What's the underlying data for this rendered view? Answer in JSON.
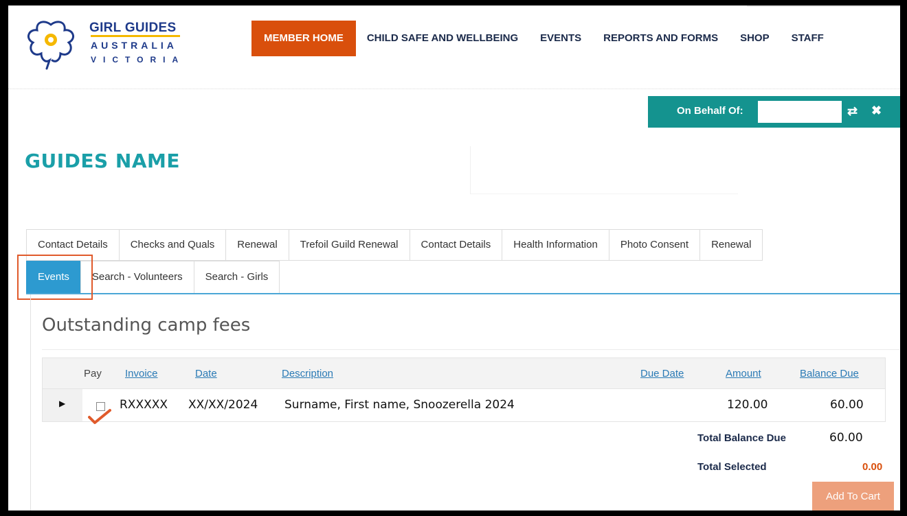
{
  "brand": {
    "line1": "GIRL GUIDES",
    "line2": "AUSTRALIA",
    "line3": "VICTORIA"
  },
  "nav": [
    {
      "label": "MEMBER HOME",
      "active": true
    },
    {
      "label": "CHILD SAFE AND WELLBEING"
    },
    {
      "label": "EVENTS"
    },
    {
      "label": "REPORTS AND FORMS"
    },
    {
      "label": "SHOP"
    },
    {
      "label": "STAFF"
    }
  ],
  "on_behalf": {
    "label": "On Behalf Of:",
    "value": ""
  },
  "guide_name": "GUIDES NAME",
  "tabs_row1": [
    "Contact Details",
    "Checks and Quals",
    "Renewal",
    "Trefoil Guild Renewal",
    "Contact Details",
    "Health Information",
    "Photo Consent",
    "Renewal"
  ],
  "tabs_row2": [
    "Events",
    "Search - Volunteers",
    "Search - Girls"
  ],
  "active_tab": "Events",
  "panel": {
    "title": "Outstanding camp fees",
    "columns": {
      "pay": "Pay",
      "invoice": "Invoice",
      "date": "Date",
      "description": "Description",
      "due_date": "Due Date",
      "amount": "Amount",
      "balance_due": "Balance Due"
    },
    "rows": [
      {
        "invoice": "RXXXXX",
        "date": "XX/XX/2024",
        "description": "Surname, First name, Snoozerella 2024",
        "due_date": "",
        "amount": "120.00",
        "balance_due": "60.00",
        "pay_checked": false
      }
    ],
    "total_balance_label": "Total Balance Due",
    "total_balance_value": "60.00",
    "total_selected_label": "Total Selected",
    "total_selected_value": "0.00",
    "add_to_cart": "Add To Cart"
  },
  "colors": {
    "nav_active": "#d94f0c",
    "teal": "#14938f",
    "guide_name": "#1a9fa8",
    "tab_active": "#2d9ad0",
    "highlight": "#e05a2b",
    "add_cart": "#eda07c",
    "total_selected": "#d94f0c"
  },
  "icons": {
    "logo": "trefoil-logo-icon",
    "expand": "expand-triangle-icon",
    "swap": "swap-arrows-icon",
    "close": "close-icon",
    "check": "checkmark-icon"
  }
}
